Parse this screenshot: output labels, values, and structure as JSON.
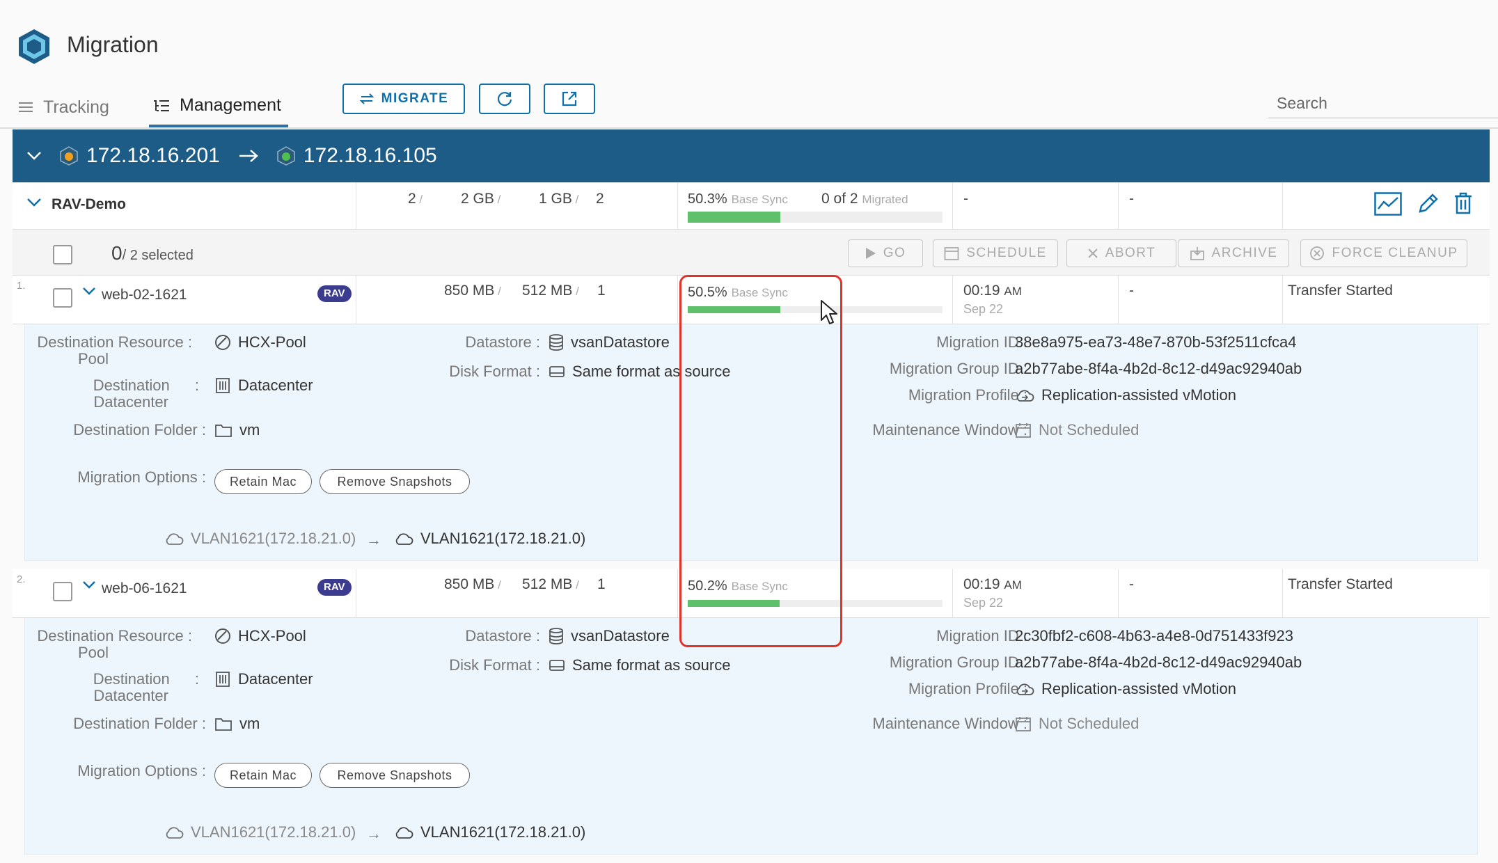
{
  "app": {
    "title": "Migration"
  },
  "nav": {
    "tabs": [
      {
        "label": "Tracking",
        "active": false
      },
      {
        "label": "Management",
        "active": true
      }
    ],
    "migrate_label": "MIGRATE",
    "search_placeholder": "Search"
  },
  "site_pair": {
    "source": "172.18.16.201",
    "destination": "172.18.16.105"
  },
  "group": {
    "name": "RAV-Demo",
    "vm_count": "2",
    "storage": "2 GB",
    "memory": "1 GB",
    "cpu": "2",
    "progress_pct": "50.3%",
    "progress_value": 0.503,
    "phase": "Base Sync",
    "migrated_count": "0 of 2",
    "migrated_label": "Migrated",
    "col_a": "-",
    "col_b": "-"
  },
  "actions": {
    "selected_count": "0",
    "selected_suffix": "/ 2 selected",
    "go": "GO",
    "schedule": "SCHEDULE",
    "abort": "ABORT",
    "archive": "ARCHIVE",
    "force_cleanup": "FORCE CLEANUP"
  },
  "migrations": [
    {
      "index": "1.",
      "name": "web-02-1621",
      "badge": "RAV",
      "storage": "850 MB",
      "memory": "512 MB",
      "cpu": "1",
      "progress_pct": "50.5%",
      "progress_value": 0.505,
      "phase": "Base Sync",
      "time": "00:19",
      "ampm": "AM",
      "date": "Sep 22",
      "dash": "-",
      "status": "Transfer Started",
      "details": {
        "dest_pool_label_1": "Destination Resource",
        "dest_pool_label_2": "Pool",
        "dest_pool": "HCX-Pool",
        "dest_dc_label_1": "Destination",
        "dest_dc_label_2": "Datacenter",
        "dest_dc": "Datacenter",
        "dest_folder_label": "Destination Folder",
        "dest_folder": "vm",
        "options_label": "Migration Options",
        "options": [
          "Retain Mac",
          "Remove Snapshots"
        ],
        "datastore_label": "Datastore",
        "datastore": "vsanDatastore",
        "disk_format_label": "Disk Format",
        "disk_format": "Same format as source",
        "migration_id_label": "Migration ID",
        "migration_id": "38e8a975-ea73-48e7-870b-53f2511cfca4",
        "group_id_label": "Migration Group ID",
        "group_id": "a2b77abe-8f4a-4b2d-8c12-d49ac92940ab",
        "profile_label": "Migration Profile",
        "profile": "Replication-assisted vMotion",
        "window_label": "Maintenance Window",
        "window": "Not Scheduled",
        "net_source": "VLAN1621(172.18.21.0)",
        "net_dest": "VLAN1621(172.18.21.0)"
      }
    },
    {
      "index": "2.",
      "name": "web-06-1621",
      "badge": "RAV",
      "storage": "850 MB",
      "memory": "512 MB",
      "cpu": "1",
      "progress_pct": "50.2%",
      "progress_value": 0.502,
      "phase": "Base Sync",
      "time": "00:19",
      "ampm": "AM",
      "date": "Sep 22",
      "dash": "-",
      "status": "Transfer Started",
      "details": {
        "dest_pool_label_1": "Destination Resource",
        "dest_pool_label_2": "Pool",
        "dest_pool": "HCX-Pool",
        "dest_dc_label_1": "Destination",
        "dest_dc_label_2": "Datacenter",
        "dest_dc": "Datacenter",
        "dest_folder_label": "Destination Folder",
        "dest_folder": "vm",
        "options_label": "Migration Options",
        "options": [
          "Retain Mac",
          "Remove Snapshots"
        ],
        "datastore_label": "Datastore",
        "datastore": "vsanDatastore",
        "disk_format_label": "Disk Format",
        "disk_format": "Same format as source",
        "migration_id_label": "Migration ID",
        "migration_id": "2c30fbf2-c608-4b63-a4e8-0d751433f923",
        "group_id_label": "Migration Group ID",
        "group_id": "a2b77abe-8f4a-4b2d-8c12-d49ac92940ab",
        "profile_label": "Migration Profile",
        "profile": "Replication-assisted vMotion",
        "window_label": "Maintenance Window",
        "window": "Not Scheduled",
        "net_source": "VLAN1621(172.18.21.0)",
        "net_dest": "VLAN1621(172.18.21.0)"
      }
    }
  ],
  "colors": {
    "accent": "#0f6fa8",
    "site_bar": "#1d5c86",
    "progress": "#5fbf6a",
    "badge": "#3b3b8f",
    "highlight": "#e0332a",
    "detail_bg": "#eef6fd"
  },
  "icons": {
    "logo": "hcx-hexagon-icon",
    "tracking": "list-icon",
    "management": "tree-list-icon",
    "migrate": "swap-arrows-icon",
    "refresh": "refresh-icon",
    "popout": "external-link-icon",
    "chart": "chart-icon",
    "edit": "pencil-icon",
    "delete": "trash-icon",
    "pool": "resource-pool-icon",
    "datacenter": "building-icon",
    "folder": "folder-icon",
    "datastore": "database-icon",
    "disk": "disk-icon",
    "profile": "cloud-sync-icon",
    "calendar": "calendar-icon",
    "network": "cloud-icon"
  }
}
